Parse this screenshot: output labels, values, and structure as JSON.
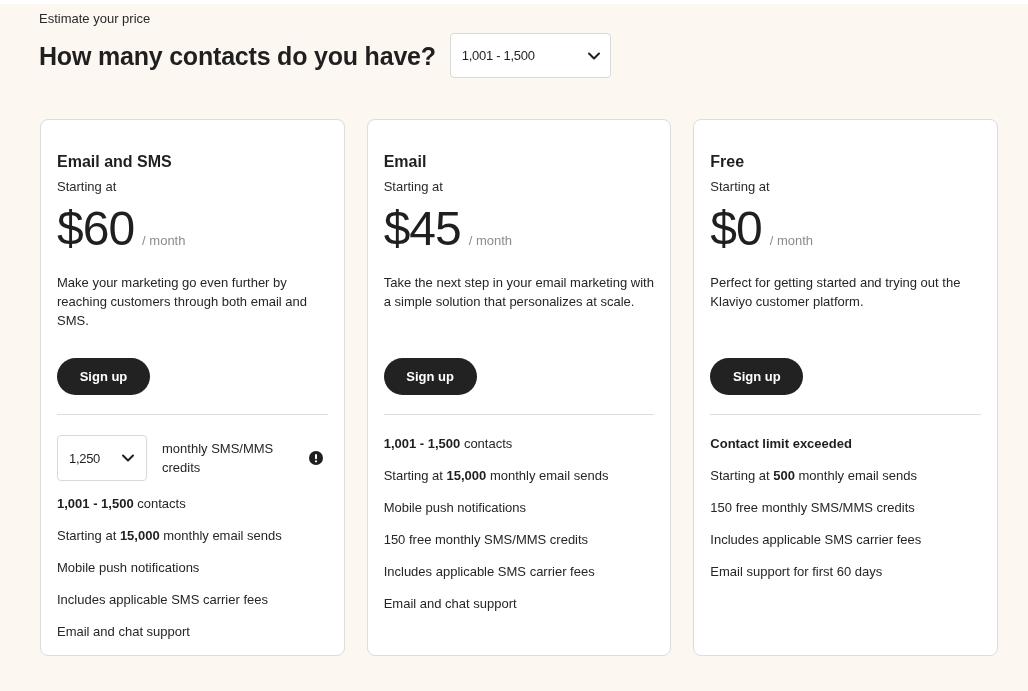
{
  "eyebrow": "Estimate your price",
  "heading": "How many contacts do you have?",
  "contacts_select": {
    "value": "1,001 - 1,500"
  },
  "plans": [
    {
      "name": "Email and SMS",
      "starting_label": "Starting at",
      "price": "$60",
      "period": "/ month",
      "description": "Make your marketing go even further by reaching customers through both email and SMS.",
      "button": "Sign up",
      "credits": {
        "value": "1,250",
        "label": "monthly SMS/MMS credits"
      },
      "features": [
        "**1,001 - 1,500** contacts",
        "Starting at **15,000** monthly email sends",
        "Mobile push notifications",
        "Includes applicable SMS carrier fees",
        "Email and chat support"
      ]
    },
    {
      "name": "Email",
      "starting_label": "Starting at",
      "price": "$45",
      "period": "/ month",
      "description": "Take the next step in your email marketing with a simple solution that personalizes at scale.",
      "button": "Sign up",
      "features": [
        "**1,001 - 1,500** contacts",
        "Starting at **15,000** monthly email sends",
        "Mobile push notifications",
        "150 free monthly SMS/MMS credits",
        "Includes applicable SMS carrier fees",
        "Email and chat support"
      ]
    },
    {
      "name": "Free",
      "starting_label": "Starting at",
      "price": "$0",
      "period": "/ month",
      "description": "Perfect for getting started and trying out the Klaviyo customer platform.",
      "button": "Sign up",
      "notice": "Contact limit exceeded",
      "features": [
        "Starting at **500** monthly email sends",
        "150 free monthly SMS/MMS credits",
        "Includes applicable SMS carrier fees",
        "Email support for first 60 days"
      ]
    }
  ]
}
